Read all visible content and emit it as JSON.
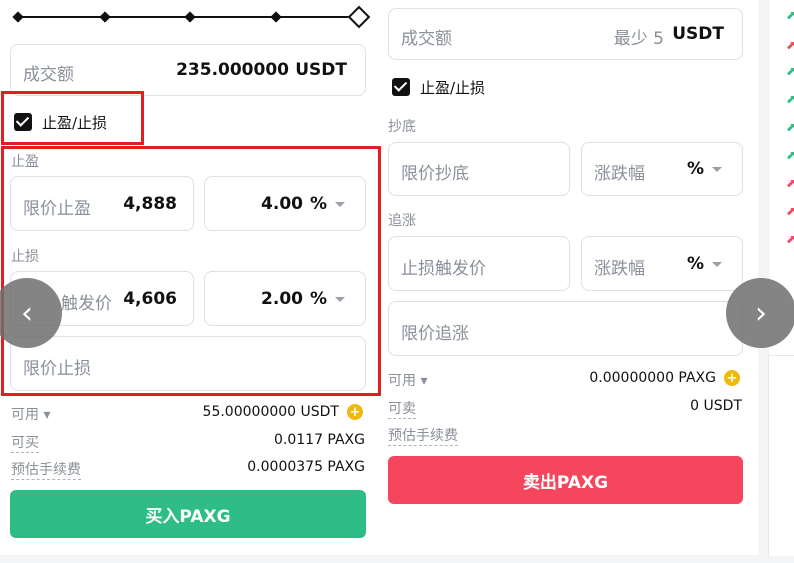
{
  "slider": {
    "marks": 5
  },
  "buy": {
    "amount": {
      "label": "成交额",
      "value": "235.000000",
      "unit": "USDT"
    },
    "tpsl": {
      "label": "止盈/止损",
      "checked": true
    },
    "take_profit": {
      "section_label": "止盈",
      "price_label": "限价止盈",
      "price_value": "4,888",
      "pct_value": "4.00",
      "pct_unit": "%"
    },
    "stop_loss": {
      "section_label": "止损",
      "trigger_label": "触发价",
      "trigger_value": "4,606",
      "pct_value": "2.00",
      "pct_unit": "%",
      "limit_label": "限价止损"
    },
    "available": {
      "label": "可用",
      "value": "55.00000000 USDT"
    },
    "can_buy": {
      "label": "可买",
      "value": "0.0117 PAXG"
    },
    "fee": {
      "label": "预估手续费",
      "value": "0.0000375 PAXG"
    },
    "button_label": "买入PAXG",
    "button_color": "#2ebd85"
  },
  "sell": {
    "amount": {
      "label": "成交额",
      "hint": "最少 5",
      "unit": "USDT"
    },
    "tpsl": {
      "label": "止盈/止损",
      "checked": true
    },
    "dip": {
      "section_label": "抄底",
      "price_label": "限价抄底",
      "pct_label": "涨跌幅",
      "pct_unit": "%"
    },
    "chase": {
      "section_label": "追涨",
      "trigger_label": "止损触发价",
      "pct_label": "涨跌幅",
      "pct_unit": "%",
      "limit_label": "限价追涨"
    },
    "available": {
      "label": "可用",
      "value": "0.00000000 PAXG"
    },
    "can_sell": {
      "label": "可卖",
      "value": "0 USDT"
    },
    "fee": {
      "label": "预估手续费"
    },
    "button_label": "卖出PAXG",
    "button_color": "#f6465d"
  },
  "nav": {
    "prev": "‹",
    "next": "›"
  },
  "colors": {
    "highlight": "#e02020"
  }
}
